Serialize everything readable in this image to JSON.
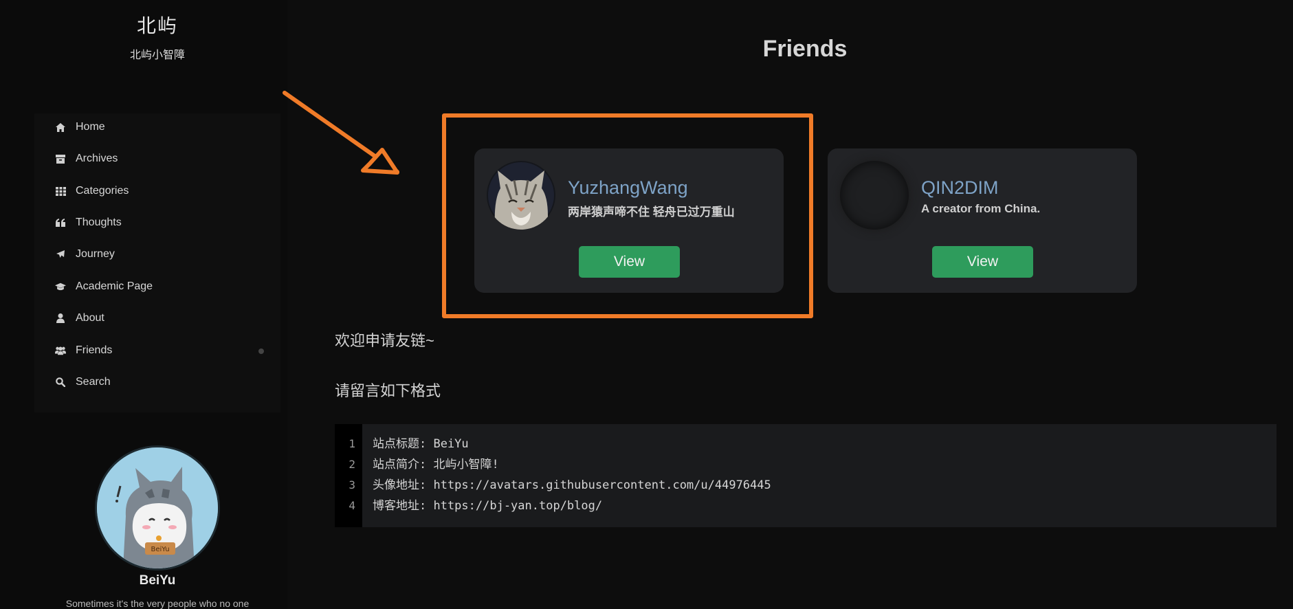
{
  "sidebar": {
    "brand_title": "北屿",
    "brand_subtitle": "北屿小智障",
    "menu": [
      {
        "label": "Home",
        "icon": "home-icon"
      },
      {
        "label": "Archives",
        "icon": "archive-icon"
      },
      {
        "label": "Categories",
        "icon": "grid-icon"
      },
      {
        "label": "Thoughts",
        "icon": "quote-icon"
      },
      {
        "label": "Journey",
        "icon": "plane-icon"
      },
      {
        "label": "Academic Page",
        "icon": "graduation-cap-icon"
      },
      {
        "label": "About",
        "icon": "user-icon"
      },
      {
        "label": "Friends",
        "icon": "users-icon"
      },
      {
        "label": "Search",
        "icon": "search-icon"
      }
    ],
    "active_item": "Friends",
    "profile": {
      "name": "BeiYu",
      "description": "Sometimes it's the very people who no one"
    }
  },
  "main": {
    "title": "Friends",
    "friends": [
      {
        "name": "YuzhangWang",
        "description": "两岸猿声啼不住 轻舟已过万重山",
        "button_label": "View",
        "avatar": "cat-avatar"
      },
      {
        "name": "QIN2DIM",
        "description": "A creator from China.",
        "button_label": "View",
        "avatar": "empty-avatar"
      }
    ],
    "notes": [
      "欢迎申请友链~",
      "请留言如下格式"
    ],
    "code": {
      "line_numbers": [
        "1",
        "2",
        "3",
        "4"
      ],
      "lines": [
        "站点标题: BeiYu",
        "站点简介: 北屿小智障!",
        "头像地址: https://avatars.githubusercontent.com/u/44976445",
        "博客地址: https://bj-yan.top/blog/"
      ]
    }
  },
  "colors": {
    "background": "#0d0d0d",
    "card": "#222326",
    "accent_green": "#2e9c5c",
    "highlight_orange": "#f07b28",
    "link_blue": "#7ea3c7"
  }
}
